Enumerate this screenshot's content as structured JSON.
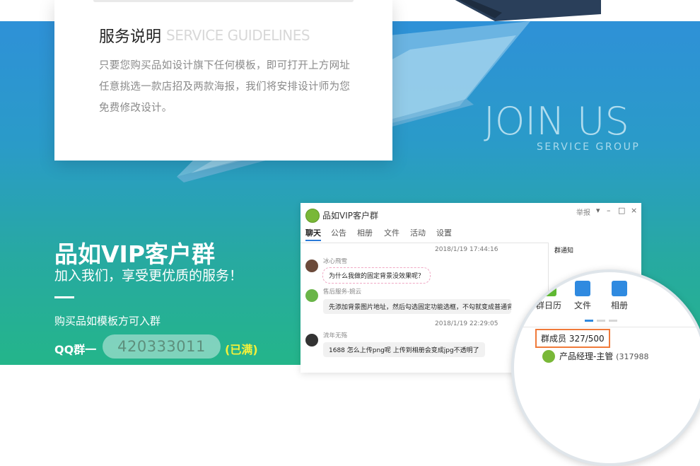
{
  "card": {
    "title": "服务说明",
    "title_en": "SERVICE GUIDELINES",
    "body": "只要您购买品如设计旗下任何模板，即可打开上方网址任意挑选一款店招及两款海报，我们将安排设计师为您免费修改设计。"
  },
  "join": {
    "title": "JOIN US",
    "subtitle": "SERVICE GROUP"
  },
  "vip": {
    "title": "品如VIP客户群",
    "subtitle": "加入我们，享受更优质的服务！",
    "note": "购买品如模板方可入群",
    "qq_label": "QQ群一",
    "qq_number": "420333011",
    "qq_status": "(已满)"
  },
  "chat_window": {
    "title": "品如VIP客户群",
    "report": "举报",
    "controls": [
      "▾",
      "–",
      "□",
      "×"
    ],
    "tabs": [
      "聊天",
      "公告",
      "相册",
      "文件",
      "活动",
      "设置"
    ],
    "notice_label": "群通知",
    "messages": [
      {
        "timestamp": "2018/1/19 17:44:16",
        "sender": "冰心飛雪",
        "text": "为什么我做的固定背景没效果呢？"
      },
      {
        "sender": "售后服务-婉云",
        "text": "先添加背景图片地址，然后勾选固定功能选框，不勾就变成普通背景了"
      },
      {
        "timestamp": "2018/1/19 22:29:05",
        "sender": "流年无殇",
        "text": "1688 怎么上传png呢  上传到相册会变成jpg不透明了"
      }
    ]
  },
  "magnifier": {
    "tools": [
      {
        "label": "群日历",
        "icon": "calendar-icon",
        "color": "#5fb833"
      },
      {
        "label": "文件",
        "icon": "file-upload-icon",
        "color": "#2f8ae0"
      },
      {
        "label": "相册",
        "icon": "photo-album-icon",
        "color": "#2f8ae0"
      }
    ],
    "members_label": "群成员 327/500",
    "member_name": "产品经理-主管",
    "member_id": "(317988"
  },
  "colors": {
    "accent_orange": "#f07a3a",
    "status_yellow": "#f4f03a"
  }
}
